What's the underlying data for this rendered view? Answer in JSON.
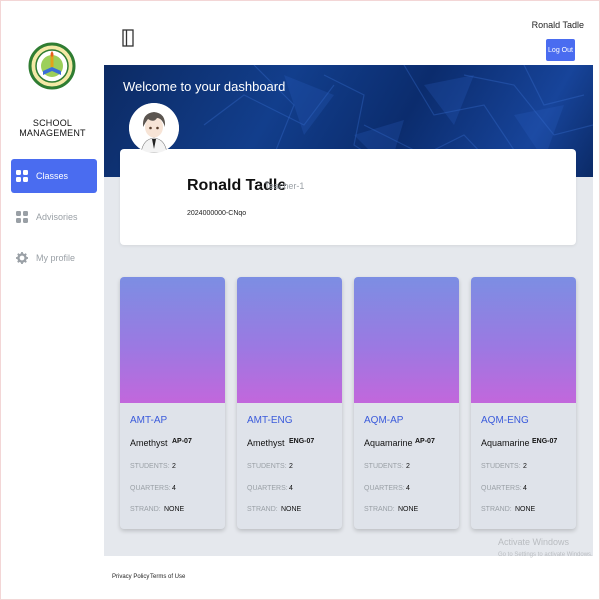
{
  "sidebar": {
    "brand": "SCHOOL MANAGEMENT",
    "items": [
      {
        "label": "Classes",
        "icon": "grid-icon",
        "active": true
      },
      {
        "label": "Advisories",
        "icon": "grid-icon",
        "active": false
      },
      {
        "label": "My profile",
        "icon": "gear-icon",
        "active": false
      }
    ]
  },
  "header": {
    "user_name": "Ronald Tadle",
    "logout_label": "Log Out"
  },
  "dashboard": {
    "welcome": "Welcome to your dashboard",
    "profile": {
      "name": "Ronald Tadle",
      "role": "- Teacher-1",
      "id": "2024000000-CNqo"
    }
  },
  "classes": [
    {
      "code": "AMT-AP",
      "section": "Amethyst",
      "subject": "AP-07",
      "students_label": "STUDENTS:",
      "students": "2",
      "quarters_label": "QUARTERS:",
      "quarters": "4",
      "strand_label": "STRAND:",
      "strand": "NONE"
    },
    {
      "code": "AMT-ENG",
      "section": "Amethyst",
      "subject": "ENG-07",
      "students_label": "STUDENTS:",
      "students": "2",
      "quarters_label": "QUARTERS:",
      "quarters": "4",
      "strand_label": "STRAND:",
      "strand": "NONE"
    },
    {
      "code": "AQM-AP",
      "section": "Aquamarine",
      "subject": "AP-07",
      "students_label": "STUDENTS:",
      "students": "2",
      "quarters_label": "QUARTERS:",
      "quarters": "4",
      "strand_label": "STRAND:",
      "strand": "NONE"
    },
    {
      "code": "AQM-ENG",
      "section": "Aquamarine",
      "subject": "ENG-07",
      "students_label": "STUDENTS:",
      "students": "2",
      "quarters_label": "QUARTERS:",
      "quarters": "4",
      "strand_label": "STRAND:",
      "strand": "NONE"
    }
  ],
  "footer": {
    "privacy": "Privacy Policy",
    "terms": "Terms of Use"
  },
  "watermark": {
    "line1": "Activate Windows",
    "line2": "Go to Settings to activate Windows."
  },
  "colors": {
    "accent": "#4a6cf0",
    "link": "#3b5bdb",
    "banner": "#123e8c",
    "card_gradient_top": "#7c8ee3",
    "card_gradient_bottom": "#c267dc"
  }
}
